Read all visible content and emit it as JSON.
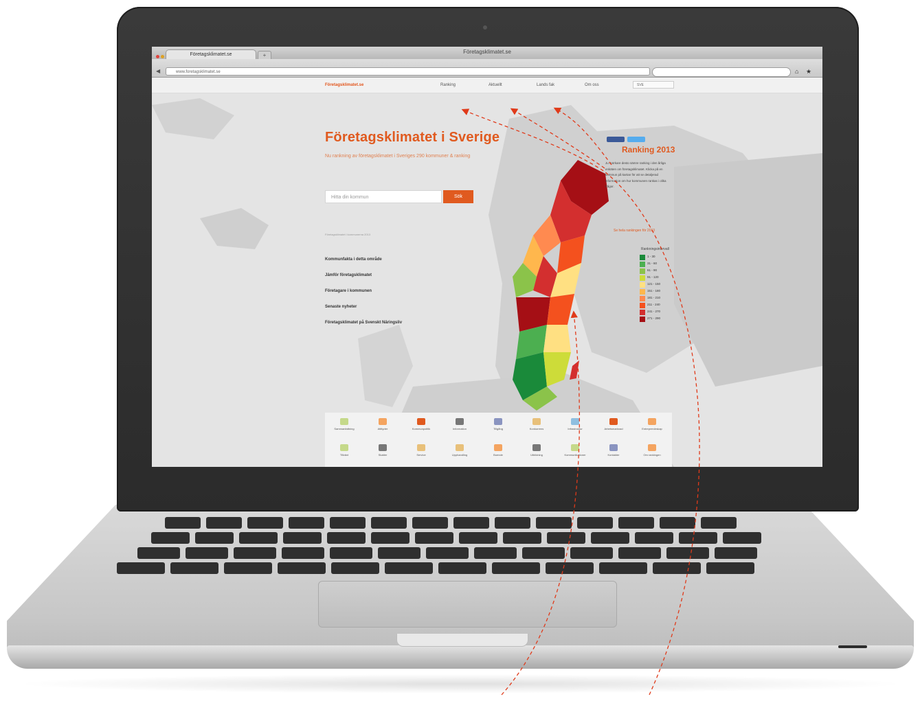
{
  "browser": {
    "window_title": "Företagsklimatet.se",
    "tab_title": "Företagsklimatet.se",
    "new_tab": "+",
    "url": "www.foretagsklimatet.se"
  },
  "site": {
    "logo": "Företagsklimatet.se",
    "nav": [
      "Ranking",
      "Aktuellt",
      "Lands fak",
      "Om oss"
    ],
    "language": "SVE",
    "hero_title": "Företagsklimatet i Sverige",
    "hero_subtitle": "Nu rankning av företagsklimatet i Sveriges 290 kommuner & ranking",
    "search_placeholder": "Hitta din kommun",
    "search_button": "Sök",
    "small_note": "Företagsklimatet i kommunerna 2013",
    "links": [
      "Kommunfakta i detta område",
      "Jämför företagsklimatet",
      "Företagare i kommunen",
      "Senaste nyheter",
      "Företagsklimatet på Svenskt Näringsliv"
    ],
    "side_title": "Ranking 2013",
    "side_text": "Ju mörkare desto sämre ranking i den årliga enkäten om företagsklimatet. Klicka på en kommun på kartan för att se detaljerad information om hur kommunen rankas i olika frågor.",
    "side_link": "Se hela rankingen för 2013",
    "legend_title": "Rankningsintervall",
    "legend": [
      {
        "label": "1 - 30",
        "color": "#1a8a3a"
      },
      {
        "label": "31 - 60",
        "color": "#4caf50"
      },
      {
        "label": "61 - 90",
        "color": "#8bc34a"
      },
      {
        "label": "91 - 120",
        "color": "#cddc39"
      },
      {
        "label": "121 - 150",
        "color": "#ffe082"
      },
      {
        "label": "151 - 180",
        "color": "#ffb74d"
      },
      {
        "label": "181 - 210",
        "color": "#ff8a50"
      },
      {
        "label": "211 - 240",
        "color": "#f4511e"
      },
      {
        "label": "241 - 270",
        "color": "#d32f2f"
      },
      {
        "label": "271 - 290",
        "color": "#a50f15"
      }
    ],
    "categories": [
      {
        "label": "Sammanfattning",
        "color": "#c5d98a"
      },
      {
        "label": "Attityder",
        "color": "#f4a460"
      },
      {
        "label": "Kommunpolitik",
        "color": "#e05a1f"
      },
      {
        "label": "Information",
        "color": "#777777"
      },
      {
        "label": "Tillgång",
        "color": "#8a94c0"
      },
      {
        "label": "Konkurrens",
        "color": "#e8c07a"
      },
      {
        "label": "Infrastruktur",
        "color": "#8fbfe0"
      },
      {
        "label": "Arbetsmarknad",
        "color": "#e05a1f"
      },
      {
        "label": "Entreprenörskap",
        "color": "#f4a460"
      },
      {
        "label": "Tillväxt",
        "color": "#c5d98a"
      },
      {
        "label": "Skatter",
        "color": "#777777"
      },
      {
        "label": "Service",
        "color": "#e8c07a"
      },
      {
        "label": "Upphandling",
        "color": "#e8c07a"
      },
      {
        "label": "Boende",
        "color": "#f4a460"
      },
      {
        "label": "Utbildning",
        "color": "#777777"
      },
      {
        "label": "Kommunikationer",
        "color": "#c5d98a"
      },
      {
        "label": "Kontakter",
        "color": "#8a94c0"
      },
      {
        "label": "Om rankingen",
        "color": "#f4a460"
      }
    ]
  }
}
